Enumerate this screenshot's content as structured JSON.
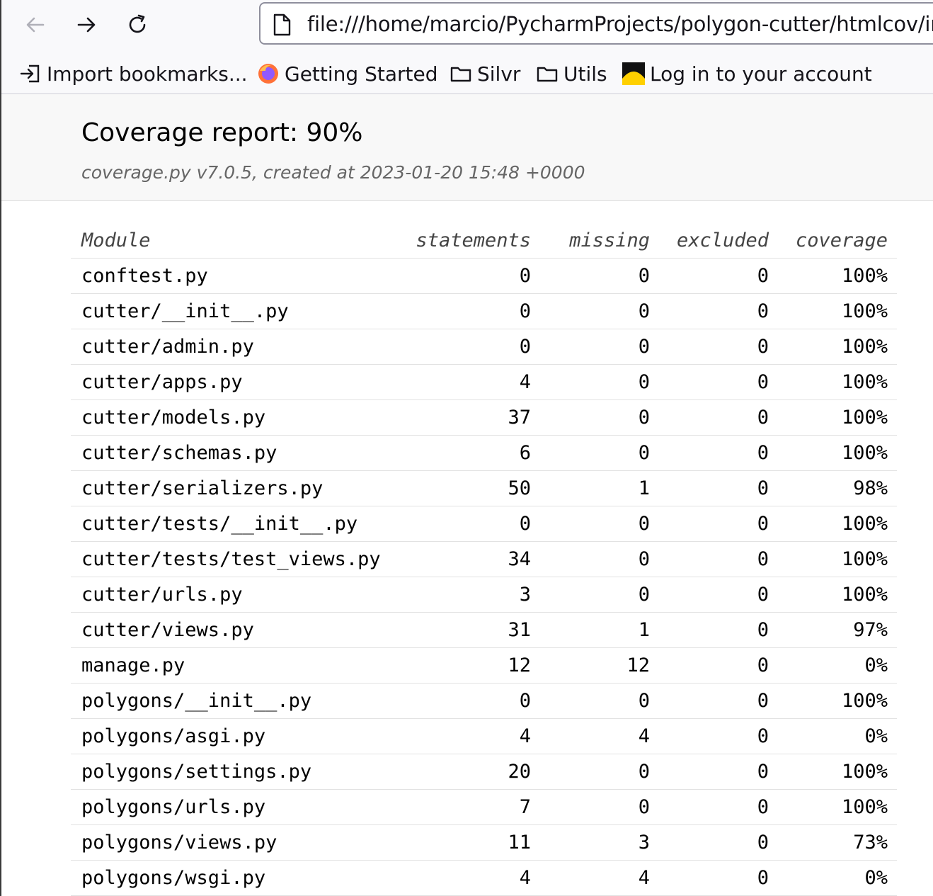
{
  "browser": {
    "url": "file:///home/marcio/PycharmProjects/polygon-cutter/htmlcov/index.html",
    "bookmarks": [
      {
        "label": "Import bookmarks...",
        "icon": "import-icon"
      },
      {
        "label": "Getting Started",
        "icon": "firefox-icon"
      },
      {
        "label": "Silvr",
        "icon": "folder-icon"
      },
      {
        "label": "Utils",
        "icon": "folder-icon"
      },
      {
        "label": "Log in to your account",
        "icon": "site-favicon"
      }
    ]
  },
  "report": {
    "title": "Coverage report: 90%",
    "subtitle": "coverage.py v7.0.5, created at 2023-01-20 15:48 +0000"
  },
  "table": {
    "headers": {
      "module": "Module",
      "statements": "statements",
      "missing": "missing",
      "excluded": "excluded",
      "coverage": "coverage"
    },
    "rows": [
      {
        "module": "conftest.py",
        "statements": "0",
        "missing": "0",
        "excluded": "0",
        "coverage": "100%"
      },
      {
        "module": "cutter/__init__.py",
        "statements": "0",
        "missing": "0",
        "excluded": "0",
        "coverage": "100%"
      },
      {
        "module": "cutter/admin.py",
        "statements": "0",
        "missing": "0",
        "excluded": "0",
        "coverage": "100%"
      },
      {
        "module": "cutter/apps.py",
        "statements": "4",
        "missing": "0",
        "excluded": "0",
        "coverage": "100%"
      },
      {
        "module": "cutter/models.py",
        "statements": "37",
        "missing": "0",
        "excluded": "0",
        "coverage": "100%"
      },
      {
        "module": "cutter/schemas.py",
        "statements": "6",
        "missing": "0",
        "excluded": "0",
        "coverage": "100%"
      },
      {
        "module": "cutter/serializers.py",
        "statements": "50",
        "missing": "1",
        "excluded": "0",
        "coverage": "98%"
      },
      {
        "module": "cutter/tests/__init__.py",
        "statements": "0",
        "missing": "0",
        "excluded": "0",
        "coverage": "100%"
      },
      {
        "module": "cutter/tests/test_views.py",
        "statements": "34",
        "missing": "0",
        "excluded": "0",
        "coverage": "100%"
      },
      {
        "module": "cutter/urls.py",
        "statements": "3",
        "missing": "0",
        "excluded": "0",
        "coverage": "100%"
      },
      {
        "module": "cutter/views.py",
        "statements": "31",
        "missing": "1",
        "excluded": "0",
        "coverage": "97%"
      },
      {
        "module": "manage.py",
        "statements": "12",
        "missing": "12",
        "excluded": "0",
        "coverage": "0%"
      },
      {
        "module": "polygons/__init__.py",
        "statements": "0",
        "missing": "0",
        "excluded": "0",
        "coverage": "100%"
      },
      {
        "module": "polygons/asgi.py",
        "statements": "4",
        "missing": "4",
        "excluded": "0",
        "coverage": "0%"
      },
      {
        "module": "polygons/settings.py",
        "statements": "20",
        "missing": "0",
        "excluded": "0",
        "coverage": "100%"
      },
      {
        "module": "polygons/urls.py",
        "statements": "7",
        "missing": "0",
        "excluded": "0",
        "coverage": "100%"
      },
      {
        "module": "polygons/views.py",
        "statements": "11",
        "missing": "3",
        "excluded": "0",
        "coverage": "73%"
      },
      {
        "module": "polygons/wsgi.py",
        "statements": "4",
        "missing": "4",
        "excluded": "0",
        "coverage": "0%"
      }
    ]
  }
}
